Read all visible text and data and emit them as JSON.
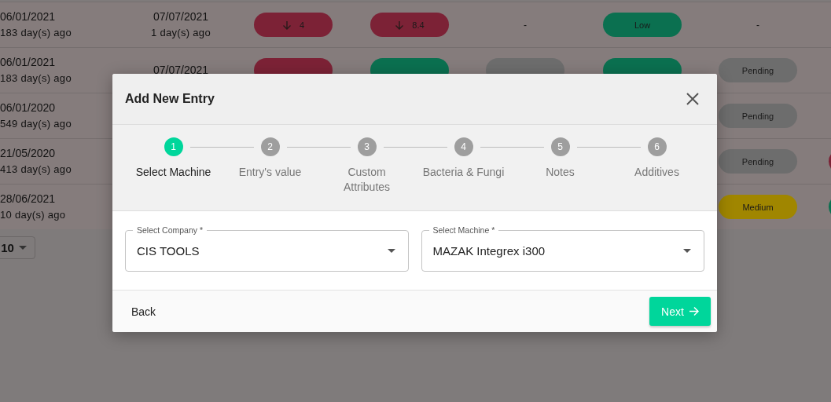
{
  "table": {
    "rows": [
      {
        "cells": [
          {
            "kind": "dates",
            "date": "06/01/2021",
            "ago": "183 day(s) ago"
          },
          {
            "kind": "dates",
            "date": "07/07/2021",
            "ago": "1 day(s) ago"
          },
          {
            "kind": "pill",
            "text": "4",
            "falling": true,
            "color": "#7c2236"
          },
          {
            "kind": "pill",
            "text": "8.4",
            "falling": true,
            "color": "#7c2236"
          },
          {
            "kind": "dash",
            "text": "-"
          },
          {
            "kind": "pill",
            "text": "Low",
            "color": "#0b7050"
          },
          {
            "kind": "dash",
            "text": "-"
          },
          {
            "kind": "blank"
          }
        ]
      },
      {
        "cells": [
          {
            "kind": "dates",
            "date": "06/01/2021",
            "ago": "183 day(s) ago"
          },
          {
            "kind": "dates",
            "date": "07/07/2021"
          },
          {
            "kind": "pill",
            "color": "#7c2236"
          },
          {
            "kind": "pill",
            "color": "#0b7050"
          },
          {
            "kind": "pill",
            "color": "#6d6d6d"
          },
          {
            "kind": "pill",
            "color": "#0b7050"
          },
          {
            "kind": "pill",
            "text": "Pending",
            "color": "#6d6d6d"
          },
          {
            "kind": "blank"
          }
        ]
      },
      {
        "cells": [
          {
            "kind": "dates",
            "date": "06/01/2020",
            "ago": "549 day(s) ago"
          },
          {
            "kind": "blank"
          },
          {
            "kind": "blank"
          },
          {
            "kind": "blank"
          },
          {
            "kind": "blank"
          },
          {
            "kind": "blank"
          },
          {
            "kind": "pill",
            "text": "Pending",
            "color": "#6d6d6d"
          },
          {
            "kind": "blank"
          }
        ]
      },
      {
        "cells": [
          {
            "kind": "dates",
            "date": "21/05/2020",
            "ago": "413 day(s) ago"
          },
          {
            "kind": "blank"
          },
          {
            "kind": "blank"
          },
          {
            "kind": "blank"
          },
          {
            "kind": "blank"
          },
          {
            "kind": "blank"
          },
          {
            "kind": "pill",
            "text": "Pending",
            "color": "#6d6d6d"
          },
          {
            "kind": "pill",
            "color": "#7c2236"
          }
        ]
      },
      {
        "cells": [
          {
            "kind": "dates",
            "date": "28/06/2021",
            "ago": "10 day(s) ago"
          },
          {
            "kind": "blank"
          },
          {
            "kind": "blank"
          },
          {
            "kind": "blank"
          },
          {
            "kind": "blank"
          },
          {
            "kind": "blank"
          },
          {
            "kind": "pill",
            "text": "Medium",
            "color": "#a08600"
          },
          {
            "kind": "pill",
            "color": "#0b7050"
          }
        ]
      }
    ],
    "rows_per_page": "10"
  },
  "dialog": {
    "title": "Add New Entry",
    "steps": [
      {
        "number": "1",
        "label": "Select Machine",
        "selected": true
      },
      {
        "number": "2",
        "label": "Entry's value",
        "selected": false
      },
      {
        "number": "3",
        "label": "Custom Attributes",
        "selected": false
      },
      {
        "number": "4",
        "label": "Bacteria & Fungi",
        "selected": false
      },
      {
        "number": "5",
        "label": "Notes",
        "selected": false
      },
      {
        "number": "6",
        "label": "Additives",
        "selected": false
      }
    ],
    "fields": [
      {
        "label": "Select Company *",
        "value": "CIS TOOLS"
      },
      {
        "label": "Select Machine *",
        "value": "MAZAK Integrex i300"
      }
    ],
    "back": "Back",
    "next": "Next"
  }
}
